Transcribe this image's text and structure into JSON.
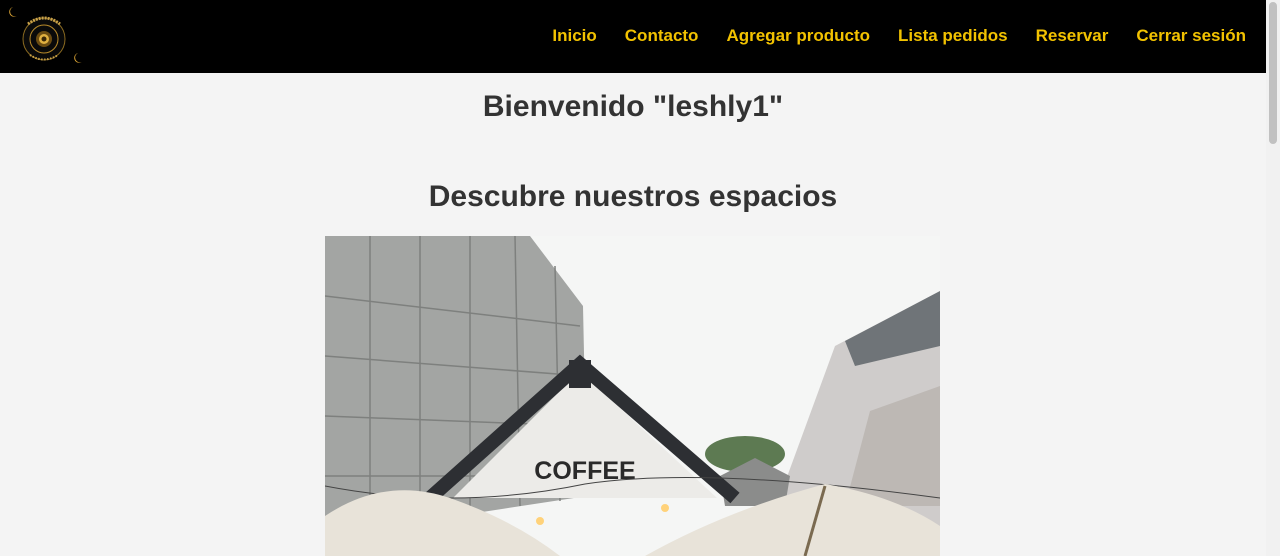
{
  "header": {
    "logo_icon": "moonlight-logo",
    "nav": [
      {
        "label": "Inicio"
      },
      {
        "label": "Contacto"
      },
      {
        "label": "Agregar producto"
      },
      {
        "label": "Lista pedidos"
      },
      {
        "label": "Reservar"
      },
      {
        "label": "Cerrar sesión"
      }
    ],
    "colors": {
      "background": "#000000",
      "link": "#f2c200"
    }
  },
  "main": {
    "welcome": "Bienvenido \"leshly1\"",
    "section_title": "Descubre nuestros espacios",
    "photo": {
      "icon": "coffee-shop-photo",
      "sign_text": "COFFEE"
    }
  }
}
